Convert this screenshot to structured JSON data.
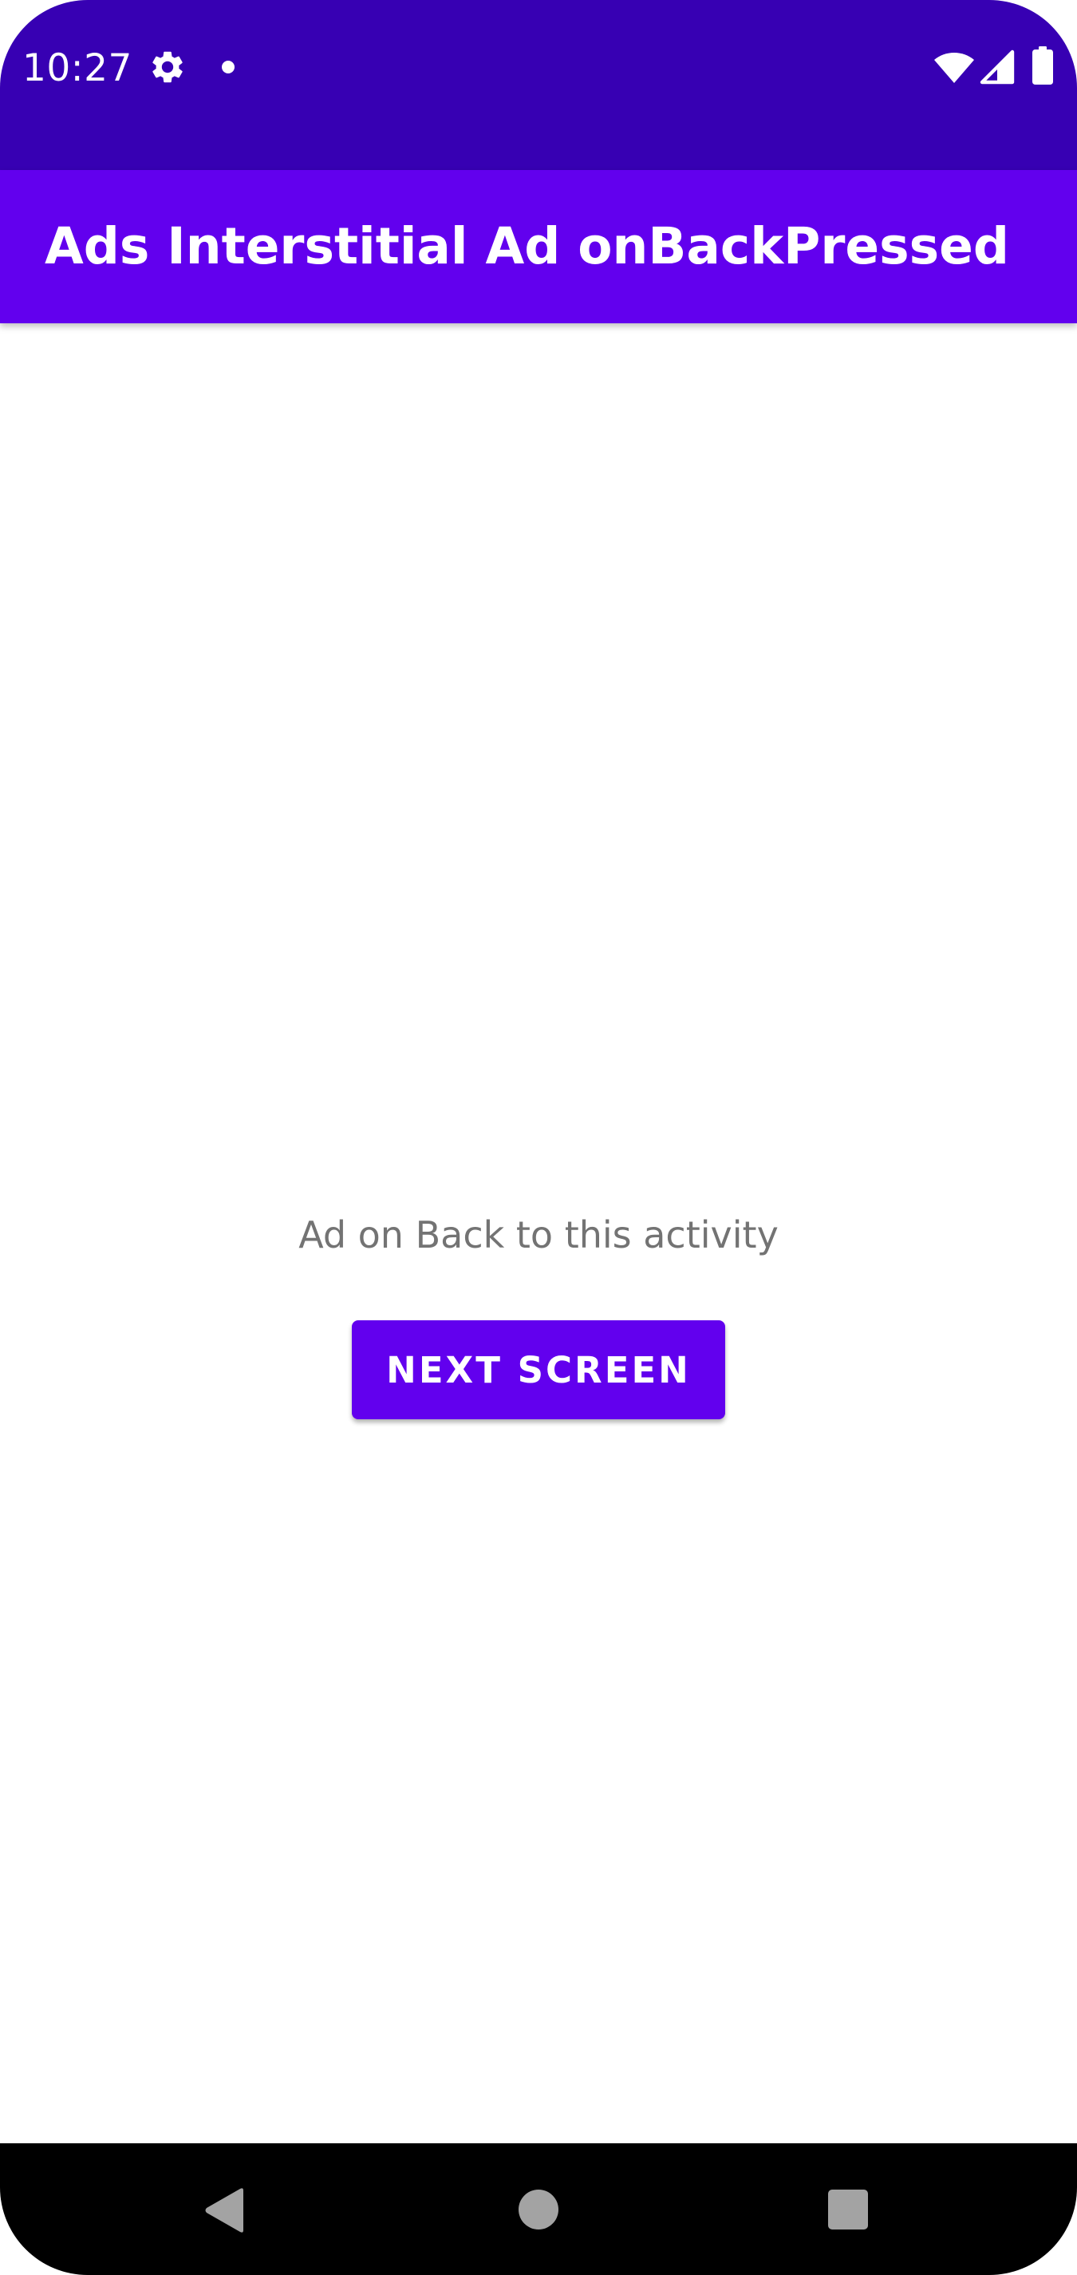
{
  "status_bar": {
    "time": "10:27",
    "icons": [
      "gear-icon",
      "notification-dot-icon",
      "wifi-icon",
      "signal-icon",
      "battery-icon"
    ],
    "background_color": "#3700b3"
  },
  "app_bar": {
    "title": "Ads Interstitial Ad onBackPressed",
    "background_color": "#6200ee"
  },
  "main": {
    "message": "Ad on Back to this activity",
    "next_button_label": "NEXT SCREEN"
  },
  "nav_bar": {
    "icons": [
      "back-icon",
      "home-icon",
      "recents-icon"
    ]
  }
}
